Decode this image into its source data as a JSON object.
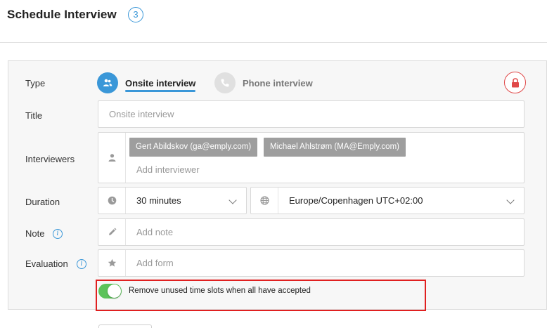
{
  "header": {
    "title": "Schedule Interview",
    "step_number": "3"
  },
  "form": {
    "type": {
      "label": "Type",
      "options": [
        {
          "label": "Onsite interview",
          "icon": "people-icon",
          "selected": true
        },
        {
          "label": "Phone interview",
          "icon": "phone-icon",
          "selected": false
        }
      ],
      "lock_icon": "lock-icon"
    },
    "title": {
      "label": "Title",
      "placeholder": "Onsite interview"
    },
    "interviewers": {
      "label": "Interviewers",
      "icon": "person-icon",
      "chips": [
        "Gert Abildskov (ga@emply.com)",
        "Michael Ahlstrøm (MA@Emply.com)"
      ],
      "placeholder": "Add interviewer"
    },
    "duration": {
      "label": "Duration",
      "icon": "clock-icon",
      "value": "30 minutes",
      "timezone_icon": "globe-icon",
      "timezone": "Europe/Copenhagen UTC+02:00"
    },
    "note": {
      "label": "Note",
      "info": "i",
      "icon": "pencil-icon",
      "placeholder": "Add note"
    },
    "evaluation": {
      "label": "Evaluation",
      "info": "i",
      "icon": "star-icon",
      "placeholder": "Add form"
    },
    "remove_slots": {
      "label": "Remove unused time slots when all have accepted",
      "enabled": true
    }
  },
  "colors": {
    "accent": "#3a97d8",
    "toggle_on": "#5cc35a",
    "lock": "#e04848",
    "highlight": "#e02020",
    "chip": "#9e9e9e"
  }
}
